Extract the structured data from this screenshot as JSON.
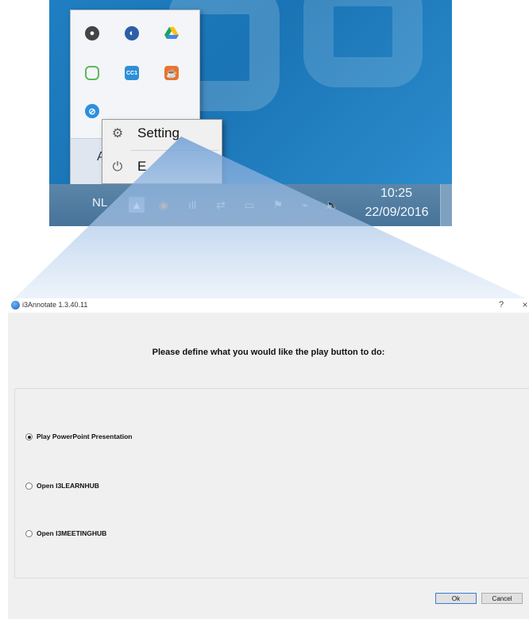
{
  "taskbar": {
    "language": "NL",
    "time": "10:25",
    "date": "22/09/2016"
  },
  "tray_popup": {
    "customize_label": "A"
  },
  "context_menu": {
    "items": [
      {
        "label": "Setting",
        "icon": "gear-icon"
      },
      {
        "label": "E",
        "icon": "power-icon"
      }
    ]
  },
  "dialog": {
    "title": "i3Annotate 1.3.40.11",
    "help": "?",
    "close": "×",
    "question": "Please define what you would like the play button to do:",
    "options": [
      {
        "label": "Play PowerPoint Presentation",
        "checked": true
      },
      {
        "label": "Open I3LEARNHUB",
        "checked": false
      },
      {
        "label": "Open I3MEETINGHUB",
        "checked": false
      }
    ],
    "ok_label": "Ok",
    "cancel_label": "Cancel"
  },
  "colors": {
    "desktop": "#1f7fc2",
    "taskbar": "#4f7aa0",
    "beam": "#8fb6e6"
  }
}
